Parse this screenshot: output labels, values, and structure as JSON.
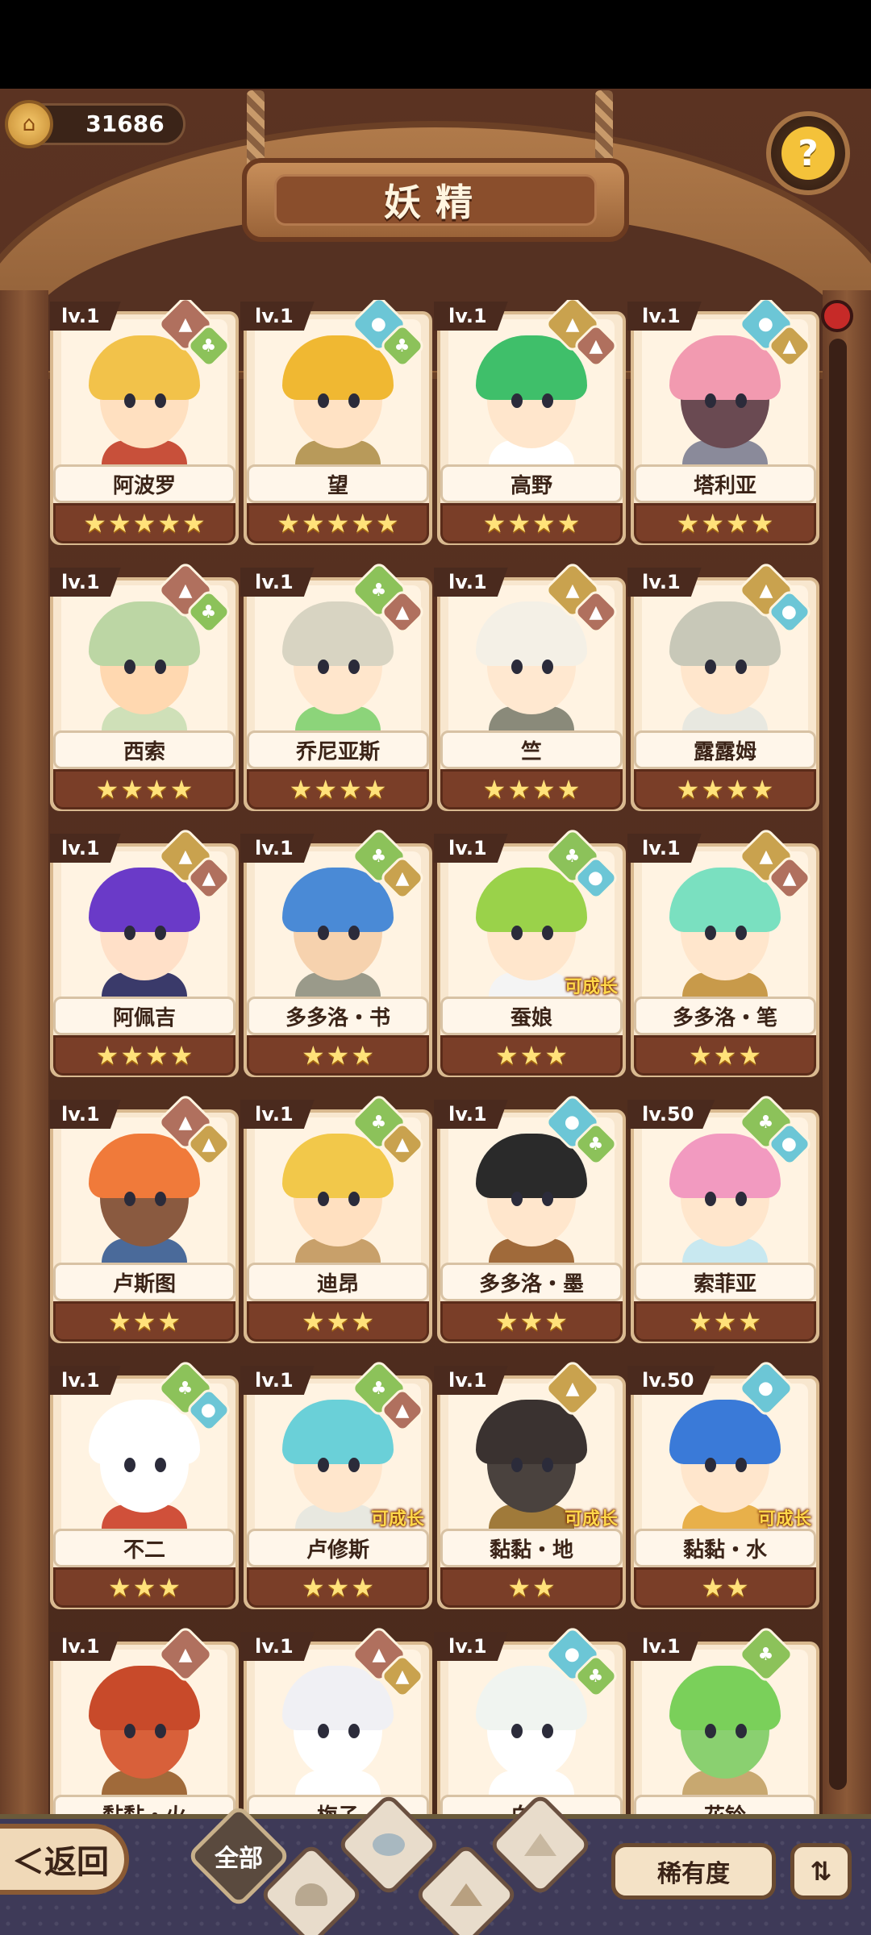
{
  "currency": {
    "value": "31686",
    "icon": "coin-icon"
  },
  "help": {
    "icon": "question-icon",
    "glyph": "?"
  },
  "title": "妖精",
  "grow_label": "可成长",
  "star_glyph": "★",
  "cards": [
    {
      "level": "lv.1",
      "name": "阿波罗",
      "stars": 5,
      "elements": [
        "fire",
        "wood"
      ],
      "grow": false,
      "hair": "#f2c24a",
      "skin": "#ffe0c0",
      "cloth": "#c8503a"
    },
    {
      "level": "lv.1",
      "name": "望",
      "stars": 5,
      "elements": [
        "water",
        "wood"
      ],
      "grow": false,
      "hair": "#f0b832",
      "skin": "#ffe2c4",
      "cloth": "#b89a5a"
    },
    {
      "level": "lv.1",
      "name": "高野",
      "stars": 4,
      "elements": [
        "earth",
        "fire"
      ],
      "grow": false,
      "hair": "#3fbf6a",
      "skin": "#ffe6cc",
      "cloth": "#ffffff"
    },
    {
      "level": "lv.1",
      "name": "塔利亚",
      "stars": 4,
      "elements": [
        "water",
        "earth"
      ],
      "grow": false,
      "hair": "#f29ab0",
      "skin": "#6a4a52",
      "cloth": "#8a8a9a"
    },
    {
      "level": "lv.1",
      "name": "西索",
      "stars": 4,
      "elements": [
        "fire",
        "wood"
      ],
      "grow": false,
      "hair": "#bcd6a4",
      "skin": "#ffd8b0",
      "cloth": "#cfe0b8"
    },
    {
      "level": "lv.1",
      "name": "乔尼亚斯",
      "stars": 4,
      "elements": [
        "wood",
        "fire"
      ],
      "grow": false,
      "hair": "#d8d4c2",
      "skin": "#ffe6cc",
      "cloth": "#8cd47a"
    },
    {
      "level": "lv.1",
      "name": "竺",
      "stars": 4,
      "elements": [
        "earth",
        "fire"
      ],
      "grow": false,
      "hair": "#f4f0e6",
      "skin": "#ffe8d0",
      "cloth": "#8a8a7a"
    },
    {
      "level": "lv.1",
      "name": "露露姆",
      "stars": 4,
      "elements": [
        "earth",
        "water"
      ],
      "grow": false,
      "hair": "#c8c8b8",
      "skin": "#ffe6cc",
      "cloth": "#e8e8e0"
    },
    {
      "level": "lv.1",
      "name": "阿佩吉",
      "stars": 4,
      "elements": [
        "earth",
        "fire"
      ],
      "grow": false,
      "hair": "#6a3ac8",
      "skin": "#ffe0c8",
      "cloth": "#3a3a6a"
    },
    {
      "level": "lv.1",
      "name": "多多洛・书",
      "stars": 3,
      "elements": [
        "wood",
        "earth"
      ],
      "grow": false,
      "hair": "#4a8ad6",
      "skin": "#f6d2ae",
      "cloth": "#9a9a8a"
    },
    {
      "level": "lv.1",
      "name": "蚕娘",
      "stars": 3,
      "elements": [
        "wood",
        "water"
      ],
      "grow": true,
      "hair": "#9ad24a",
      "skin": "#ffe6cc",
      "cloth": "#f4f4f4"
    },
    {
      "level": "lv.1",
      "name": "多多洛・笔",
      "stars": 3,
      "elements": [
        "earth",
        "fire"
      ],
      "grow": false,
      "hair": "#7ae0c0",
      "skin": "#ffe6cc",
      "cloth": "#c89a4a"
    },
    {
      "level": "lv.1",
      "name": "卢斯图",
      "stars": 3,
      "elements": [
        "fire",
        "earth"
      ],
      "grow": false,
      "hair": "#f07a3a",
      "skin": "#8a5a40",
      "cloth": "#4a6a9a"
    },
    {
      "level": "lv.1",
      "name": "迪昂",
      "stars": 3,
      "elements": [
        "wood",
        "earth"
      ],
      "grow": false,
      "hair": "#f2c84a",
      "skin": "#ffe0c0",
      "cloth": "#c8a06a"
    },
    {
      "level": "lv.1",
      "name": "多多洛・墨",
      "stars": 3,
      "elements": [
        "water",
        "wood"
      ],
      "grow": false,
      "hair": "#2a2a2a",
      "skin": "#ffe6cc",
      "cloth": "#a06a3a"
    },
    {
      "level": "lv.50",
      "name": "索菲亚",
      "stars": 3,
      "elements": [
        "wood",
        "water"
      ],
      "grow": false,
      "hair": "#f29ac0",
      "skin": "#ffe6cc",
      "cloth": "#c8e8f0"
    },
    {
      "level": "lv.1",
      "name": "不二",
      "stars": 3,
      "elements": [
        "wood",
        "water"
      ],
      "grow": false,
      "hair": "#ffffff",
      "skin": "#ffffff",
      "cloth": "#d0503a"
    },
    {
      "level": "lv.1",
      "name": "卢修斯",
      "stars": 3,
      "elements": [
        "wood",
        "fire"
      ],
      "grow": true,
      "hair": "#6ad0d8",
      "skin": "#ffe6cc",
      "cloth": "#e8e8e0"
    },
    {
      "level": "lv.1",
      "name": "黏黏・地",
      "stars": 2,
      "elements": [
        "earth"
      ],
      "grow": true,
      "hair": "#3a3230",
      "skin": "#4a423e",
      "cloth": "#a07a3a"
    },
    {
      "level": "lv.50",
      "name": "黏黏・水",
      "stars": 2,
      "elements": [
        "water"
      ],
      "grow": true,
      "hair": "#3a7ad8",
      "skin": "#ffe6cc",
      "cloth": "#e8b04a"
    },
    {
      "level": "lv.1",
      "name": "黏黏・火",
      "stars": 0,
      "elements": [
        "fire"
      ],
      "grow": false,
      "hair": "#c84a2a",
      "skin": "#d8603a",
      "cloth": "#a06a3a"
    },
    {
      "level": "lv.1",
      "name": "梅子",
      "stars": 0,
      "elements": [
        "fire",
        "earth"
      ],
      "grow": false,
      "hair": "#f0f0f4",
      "skin": "#ffffff",
      "cloth": "#ffffff"
    },
    {
      "level": "lv.1",
      "name": "白菇",
      "stars": 0,
      "elements": [
        "water",
        "wood"
      ],
      "grow": false,
      "hair": "#f0f4f0",
      "skin": "#ffffff",
      "cloth": "#ffffff"
    },
    {
      "level": "lv.1",
      "name": "花铃",
      "stars": 0,
      "elements": [
        "wood"
      ],
      "grow": false,
      "hair": "#7ad05a",
      "skin": "#8ad070",
      "cloth": "#c8a870"
    }
  ],
  "bottom": {
    "back": "＜返回",
    "filters": [
      {
        "label": "全部",
        "icon": "all-filter",
        "active": true
      },
      {
        "label": "",
        "icon": "sprout-filter-icon",
        "active": false
      },
      {
        "label": "",
        "icon": "water-drop-filter-icon",
        "active": false
      },
      {
        "label": "",
        "icon": "mountain-filter-icon",
        "active": false
      },
      {
        "label": "",
        "icon": "snow-mountain-filter-icon",
        "active": false
      }
    ],
    "rarity": "稀有度",
    "sort": "⇅"
  },
  "colors": {
    "earth": "#c9a24e",
    "water": "#6cc6d6",
    "wood": "#8cc25a",
    "fire": "#b0705e"
  }
}
